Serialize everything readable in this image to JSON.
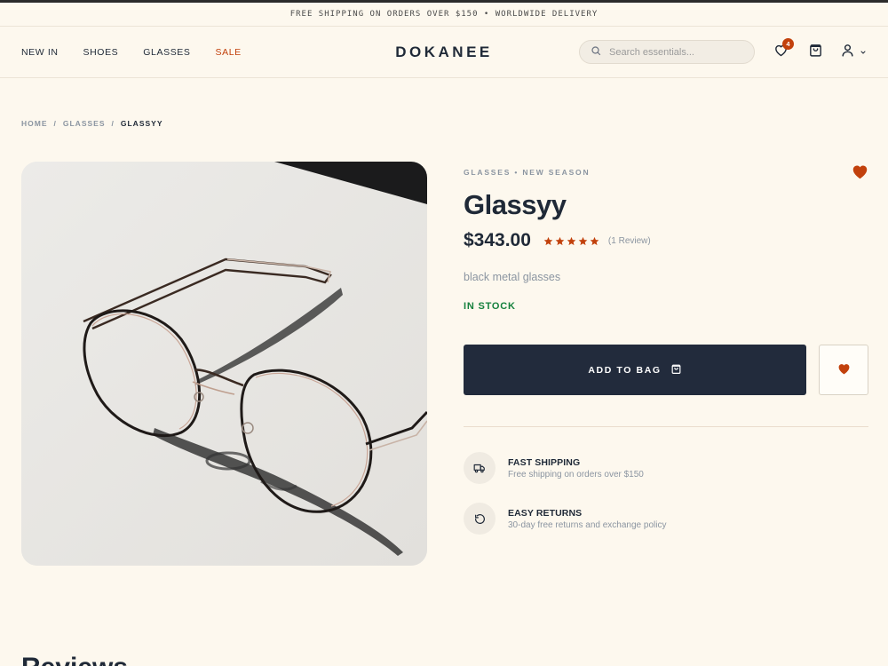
{
  "announcement": "FREE SHIPPING ON ORDERS OVER $150 • WORLDWIDE DELIVERY",
  "nav": {
    "items": [
      {
        "label": "NEW IN"
      },
      {
        "label": "SHOES"
      },
      {
        "label": "GLASSES"
      },
      {
        "label": "SALE"
      }
    ]
  },
  "brand": "DOKANEE",
  "search": {
    "placeholder": "Search essentials...",
    "value": ""
  },
  "header_icons": {
    "wishlist_icon": "heart-icon",
    "wishlist_count": "4",
    "cart_icon": "shopping-bag-icon",
    "account_icon": "user-icon",
    "account_dropdown_icon": "chevron-down-icon"
  },
  "breadcrumb": {
    "items": [
      "HOME",
      "GLASSES",
      "GLASSYY"
    ],
    "separator": "/"
  },
  "product": {
    "image_icon": "glasses-photo",
    "eyebrow": "GLASSES • NEW SEASON",
    "title": "Glassyy",
    "price": "$343.00",
    "rating": 5,
    "rating_max": 5,
    "review_count": "(1 Review)",
    "description": "black metal glasses",
    "stock": "IN STOCK",
    "add_to_bag": "ADD TO BAG",
    "add_to_bag_icon": "shopping-bag-icon",
    "wishlist_icon": "heart-icon"
  },
  "features": [
    {
      "icon": "truck-icon",
      "title": "FAST SHIPPING",
      "desc": "Free shipping on orders over $150"
    },
    {
      "icon": "rotate-ccw-icon",
      "title": "EASY RETURNS",
      "desc": "30-day free returns and exchange policy"
    }
  ],
  "reviews_heading": "Reviews",
  "colors": {
    "background": "#fdf8ee",
    "primary_dark": "#222b3c",
    "accent": "#c2410c",
    "in_stock": "#15803d",
    "muted": "#8b95a1"
  }
}
